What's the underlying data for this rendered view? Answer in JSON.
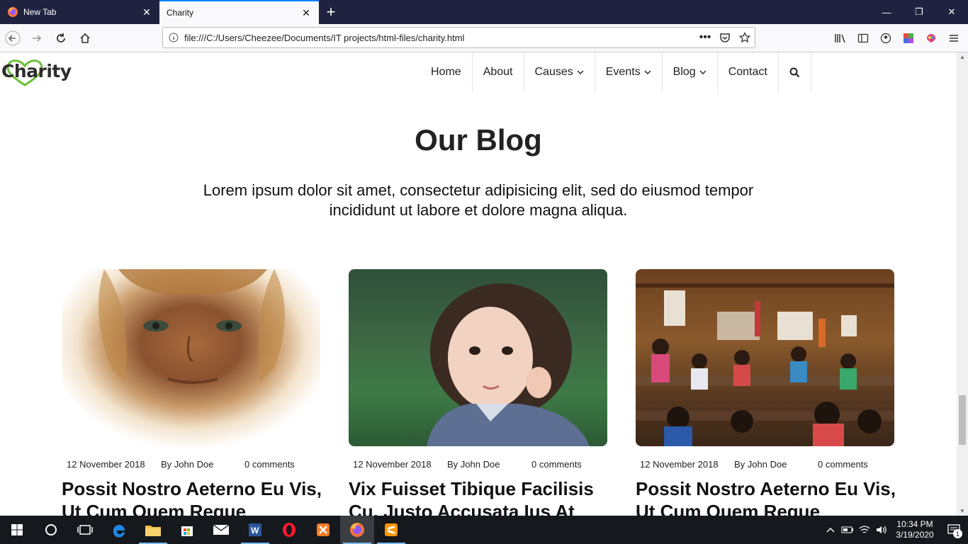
{
  "browser": {
    "tabs": [
      {
        "label": "New Tab",
        "active": false
      },
      {
        "label": "Charity",
        "active": true
      }
    ],
    "url": "file:///C:/Users/Cheezee/Documents/IT projects/html-files/charity.html"
  },
  "site": {
    "logo_text": "Charity",
    "nav": [
      {
        "label": "Home",
        "dropdown": false
      },
      {
        "label": "About",
        "dropdown": false
      },
      {
        "label": "Causes",
        "dropdown": true
      },
      {
        "label": "Events",
        "dropdown": true
      },
      {
        "label": "Blog",
        "dropdown": true
      },
      {
        "label": "Contact",
        "dropdown": false
      }
    ]
  },
  "blog": {
    "title": "Our Blog",
    "subtitle": "Lorem ipsum dolor sit amet, consectetur adipisicing elit, sed do eiusmod tempor incididunt ut labore et dolore magna aliqua.",
    "posts": [
      {
        "date": "12 November 2018",
        "author": "By John Doe",
        "comments": "0 comments",
        "title": "Possit Nostro Aeterno Eu Vis, Ut Cum Quem Reque",
        "image": "girl-face-photo"
      },
      {
        "date": "12 November 2018",
        "author": "By John Doe",
        "comments": "0 comments",
        "title": "Vix Fuisset Tibique Facilisis Cu. Justo Accusata Ius At",
        "image": "child-in-field-photo"
      },
      {
        "date": "12 November 2018",
        "author": "By John Doe",
        "comments": "0 comments",
        "title": "Possit Nostro Aeterno Eu Vis, Ut Cum Quem Reque",
        "image": "classroom-photo"
      }
    ]
  },
  "taskbar": {
    "time": "10:34 PM",
    "date": "3/19/2020",
    "notifications": "1"
  },
  "colors": {
    "tabstrip": "#202340",
    "accent": "#0a84ff",
    "logo_heart": "#6cbf3a",
    "taskbar": "#15181d"
  }
}
